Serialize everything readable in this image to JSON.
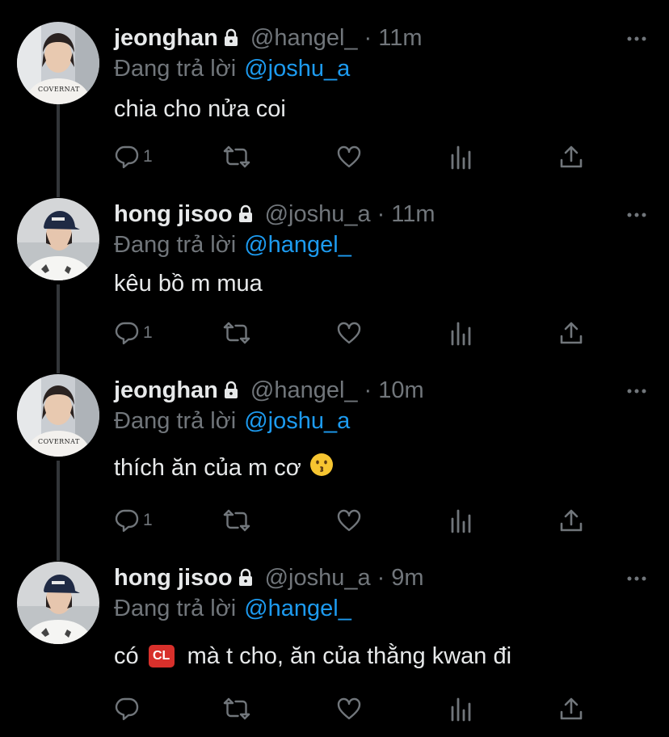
{
  "tweets": [
    {
      "name": "jeonghan",
      "handle": "@hangel_",
      "sep": "·",
      "time": "11m",
      "reply_prefix": "Đang trả lời",
      "reply_to": "@joshu_a",
      "text": "chia cho nửa coi",
      "reply_count": "1",
      "avatar": "avatar-jeonghan"
    },
    {
      "name": "hong jisoo",
      "handle": "@joshu_a",
      "sep": "·",
      "time": "11m",
      "reply_prefix": "Đang trả lời",
      "reply_to": "@hangel_",
      "text": "kêu bồ m mua",
      "reply_count": "1",
      "avatar": "avatar-jisoo"
    },
    {
      "name": "jeonghan",
      "handle": "@hangel_",
      "sep": "·",
      "time": "10m",
      "reply_prefix": "Đang trả lời",
      "reply_to": "@joshu_a",
      "text": "thích ăn của m cơ",
      "emoji": "kissing-face",
      "reply_count": "1",
      "avatar": "avatar-jeonghan"
    },
    {
      "name": "hong jisoo",
      "handle": "@joshu_a",
      "sep": "·",
      "time": "9m",
      "reply_prefix": "Đang trả lời",
      "reply_to": "@hangel_",
      "text_before": "có",
      "badge": "CL",
      "text_after": "mà t cho, ăn của thằng kwan đi",
      "reply_count": "",
      "avatar": "avatar-jisoo"
    }
  ],
  "avatar_print": "COVERNAT",
  "icons": [
    "lock-icon",
    "more-icon",
    "reply-icon",
    "retweet-icon",
    "like-icon",
    "analytics-icon",
    "share-icon"
  ],
  "colors": {
    "background": "#000000",
    "text": "#e7e9ea",
    "muted": "#71767b",
    "link": "#1d9bf0",
    "thread_line": "#333639",
    "badge": "#d8302b"
  }
}
